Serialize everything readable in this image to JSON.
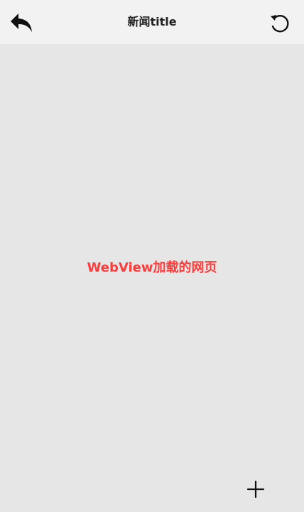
{
  "header": {
    "title": "新闻title",
    "back_icon": "back-arrow-icon",
    "refresh_icon": "refresh-icon"
  },
  "webview": {
    "placeholder_text": "WebView加载的网页",
    "text_color": "#ff3b3b"
  },
  "fab": {
    "icon": "plus-icon"
  },
  "colors": {
    "header_background": "#f2f2f2",
    "page_background": "#e6e6e6",
    "title_color": "#222222"
  }
}
